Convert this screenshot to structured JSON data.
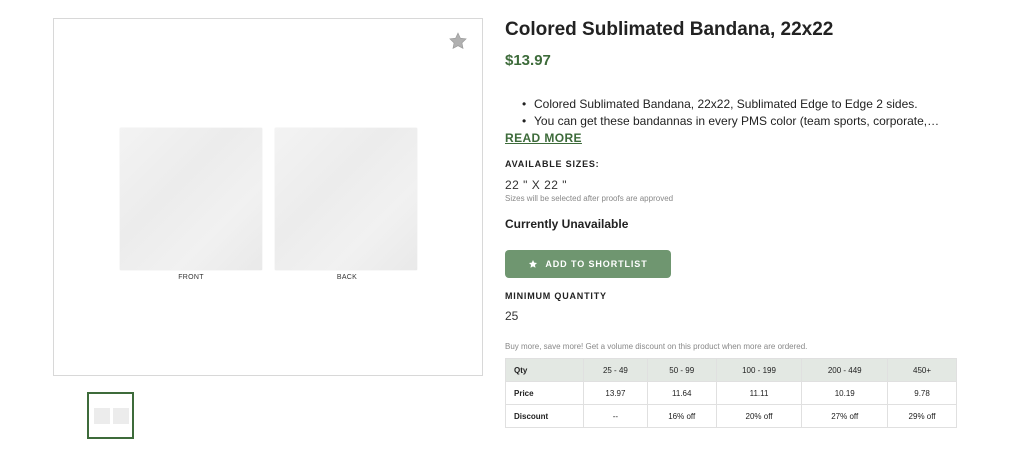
{
  "product": {
    "title": "Colored Sublimated Bandana, 22x22",
    "price": "$13.97",
    "image_labels": {
      "front": "FRONT",
      "back": "BACK"
    },
    "description_bullets": [
      "Colored Sublimated Bandana, 22x22, Sublimated Edge to Edge 2 sides.",
      "You can get these bandannas in every PMS color (team sports, corporate, …"
    ],
    "read_more": "READ MORE"
  },
  "sizes": {
    "label": "AVAILABLE SIZES:",
    "value": "22 \" X 22 \"",
    "note": "Sizes will be selected after proofs are approved"
  },
  "availability": "Currently Unavailable",
  "shortlist_button": {
    "label": "ADD TO SHORTLIST",
    "icon": "star-icon"
  },
  "min_quantity": {
    "label": "MINIMUM QUANTITY",
    "value": "25"
  },
  "volume_note": "Buy more, save more! Get a volume discount on this product when more are ordered.",
  "pricing_table": {
    "header": [
      "Qty",
      "25 - 49",
      "50 - 99",
      "100 - 199",
      "200 - 449",
      "450+"
    ],
    "rows": [
      [
        "Price",
        "13.97",
        "11.64",
        "11.11",
        "10.19",
        "9.78"
      ],
      [
        "Discount",
        "--",
        "16% off",
        "20% off",
        "27% off",
        "29% off"
      ]
    ]
  },
  "colors": {
    "accent": "#3d6b3a",
    "button": "#6f9670",
    "table_header": "#e3e8e3"
  }
}
